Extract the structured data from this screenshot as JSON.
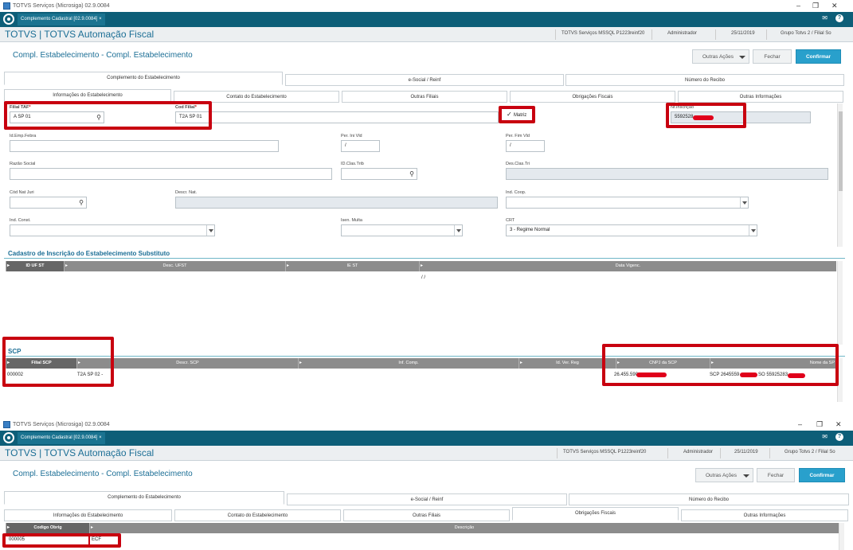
{
  "titlebar": {
    "title": "TOTVS Serviços (Microsiga) 02.9.0084"
  },
  "tab": {
    "label": "Complemento Cadastral [02.9.0084]",
    "close": "×"
  },
  "app_header": {
    "title": "TOTVS | TOTVS Automação Fiscal",
    "env": "TOTVS Serviços MSSQL P1223reinf20",
    "user": "Administrador",
    "date": "25/11/2019",
    "group": "Grupo Totvs 2 / Filial So"
  },
  "page": {
    "title": "Compl. Estabelecimento - Compl. Estabelecimento",
    "other_actions": "Outras Ações",
    "close": "Fechar",
    "confirm": "Confirmar"
  },
  "main_tabs": [
    "Complemento do Estabelecimento",
    "e-Social / Reinf",
    "Número do Recibo"
  ],
  "sub_tabs": [
    "Informações do Estabelecimento",
    "Contato do Estabelecimento",
    "Outras Filiais",
    "Obrigações Fiscais",
    "Outras Informações"
  ],
  "form": {
    "filial_taf": {
      "label": "Filial TAF",
      "req": "*",
      "value": "A SP 01"
    },
    "cod_filial": {
      "label": "Cod Filial",
      "req": "*",
      "value": "T2A SP 01"
    },
    "matriz": {
      "label": "Matriz",
      "check": "✓"
    },
    "nr_inscricao": {
      "label": "Nr.Inscrição",
      "value": "5592528"
    },
    "id_emp_febra": {
      "label": "Id.Emp.Febra",
      "value": ""
    },
    "per_ini_vld": {
      "label": "Per. Ini Vld",
      "value": "/"
    },
    "per_fim_vld": {
      "label": "Per. Fim Vld",
      "value": "/"
    },
    "razao_social": {
      "label": "Razão Social",
      "value": ""
    },
    "id_clas_trib": {
      "label": "ID.Clas.Trib",
      "value": ""
    },
    "des_clas_tri": {
      "label": "Des.Clas.Tri",
      "value": ""
    },
    "cod_nat_juri": {
      "label": "Cód Nat Juri",
      "value": ""
    },
    "descr_nat": {
      "label": "Descr. Nat.",
      "value": ""
    },
    "ind_coop": {
      "label": "Ind. Coop.",
      "value": ""
    },
    "ind_const": {
      "label": "Ind. Const.",
      "value": ""
    },
    "isen_multa": {
      "label": "Isen. Multa",
      "value": ""
    },
    "crt": {
      "label": "CRT",
      "value": "3 - Regime Normal"
    }
  },
  "substituto": {
    "title": "Cadastro de Inscrição do Estabelecimento Substituto",
    "columns": [
      "ID UF ST",
      "Desc. UFST",
      "IE ST",
      "Data Vigenc."
    ],
    "row": {
      "date": "/ /"
    }
  },
  "scp": {
    "title": "SCP",
    "columns": [
      "Filial SCP",
      "Descr. SCP",
      "Inf. Comp.",
      "Id. Ver. Reg",
      "CNPJ da SCP",
      "Nome da SP"
    ],
    "row": {
      "filial": "000002",
      "descr": "T2A SP 02 -",
      "cnpj": "26.455.590",
      "nome_a": "SCP 2645559",
      "nome_b": "SO 55925283"
    }
  },
  "obrig": {
    "columns": [
      "Codigo Obrig",
      "Descrição"
    ],
    "row": {
      "codigo": "000005",
      "descricao": "ECF"
    }
  },
  "colors": {
    "teal": "#0d5e78",
    "accent": "#29a0cc",
    "highlight": "#c8000f"
  }
}
